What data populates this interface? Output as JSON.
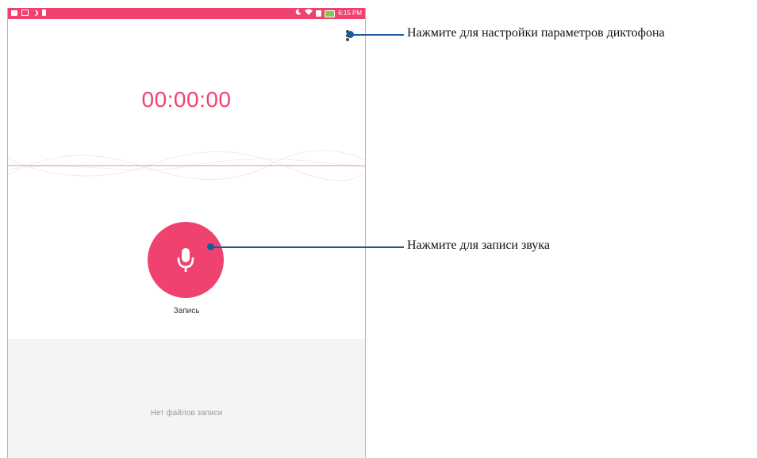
{
  "status_bar": {
    "time": "6:15 PM",
    "left_icons": [
      "image-icon",
      "cast-icon",
      "moon-icon",
      "sd-card-icon"
    ],
    "right_icons": [
      "moon-icon",
      "wifi-icon",
      "sim-icon",
      "battery-icon"
    ],
    "color": "#f0426e"
  },
  "recorder": {
    "timer": "00:00:00",
    "record_label": "Запись",
    "no_files": "Нет файлов записи",
    "accent_color": "#f0426e"
  },
  "callouts": {
    "settings": "Нажмите для настройки параметров диктофона",
    "record": "Нажмите для записи звука",
    "line_color": "#1a5a9a"
  }
}
